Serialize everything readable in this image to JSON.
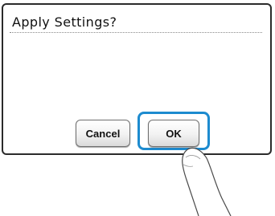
{
  "dialog": {
    "title": "Apply Settings?"
  },
  "buttons": {
    "cancel_label": "Cancel",
    "ok_label": "OK"
  },
  "colors": {
    "highlight": "#1d8bcf",
    "border": "#2b2b2b"
  },
  "icons": {
    "pointer": "finger-tap-icon"
  }
}
